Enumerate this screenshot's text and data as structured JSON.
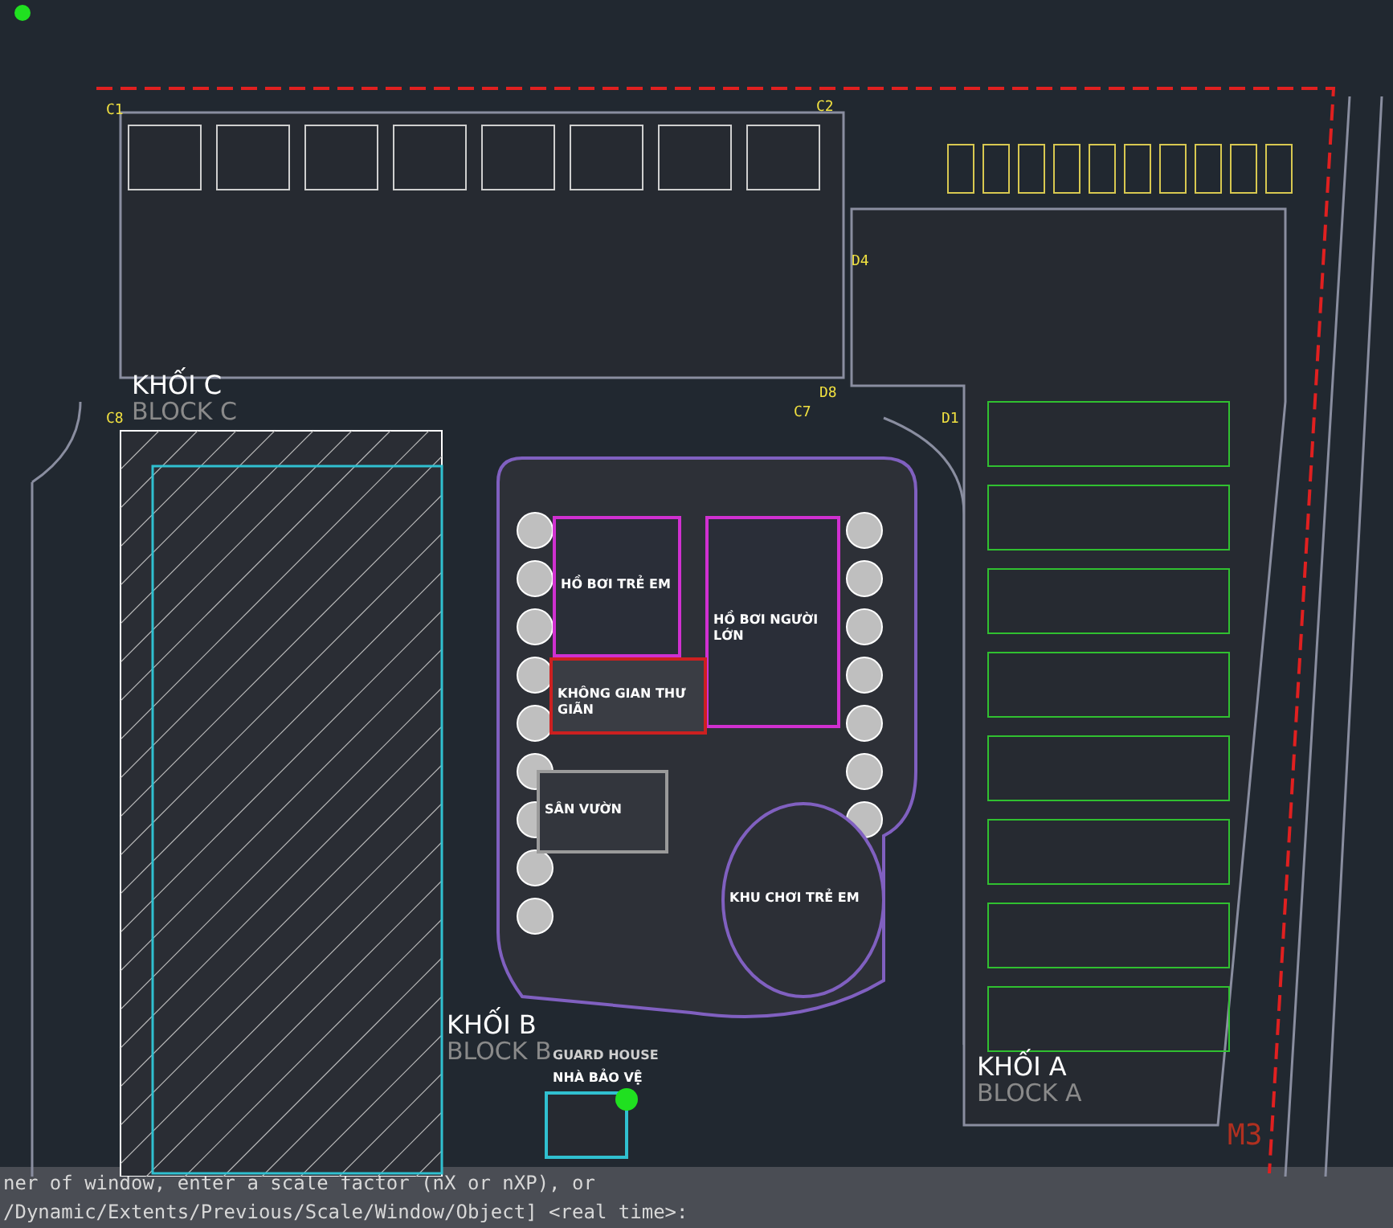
{
  "drawing": {
    "blocks": [
      {
        "name": "KHỐI C",
        "subtitle": "BLOCK C"
      },
      {
        "name": "KHỐI B",
        "subtitle": "BLOCK B"
      },
      {
        "name": "KHỐI A",
        "subtitle": "BLOCK A"
      }
    ],
    "areas": [
      {
        "kind": "pool",
        "label": "HỒ BƠI TRẺ EM"
      },
      {
        "kind": "pool",
        "label": "HỒ BƠI NGƯỜI LỚN"
      },
      {
        "kind": "plaza",
        "label": "KHÔNG GIAN THƯ GIÃN"
      },
      {
        "kind": "garden",
        "label": "SÂN VƯỜN"
      },
      {
        "kind": "play",
        "label": "KHU CHƠI TRẺ EM"
      },
      {
        "kind": "guard",
        "label": "NHÀ BẢO VỆ"
      }
    ],
    "guard_house_en": "GUARD HOUSE",
    "grid_marks": [
      "C1",
      "C2",
      "C8",
      "C7",
      "D1",
      "D4",
      "D8",
      "M3"
    ]
  },
  "command_line": [
    "ner of window, enter a scale factor (nX or nXP), or",
    "/Dynamic/Extents/Previous/Scale/Window/Object] <real time>:"
  ]
}
